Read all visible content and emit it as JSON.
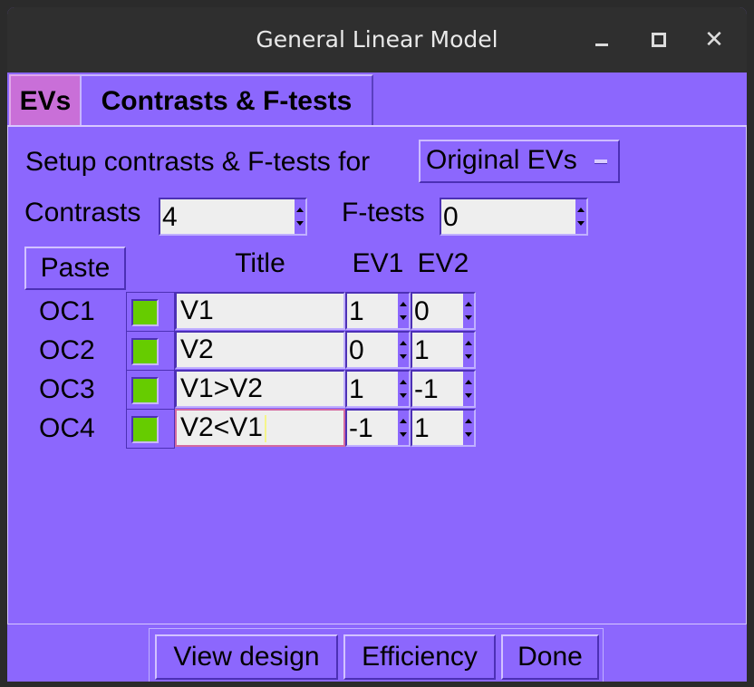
{
  "window": {
    "title": "General Linear Model",
    "controls": {
      "minimize": "minimize",
      "maximize": "maximize",
      "close": "✕"
    }
  },
  "tabs": [
    {
      "label": "EVs",
      "active": false
    },
    {
      "label": "Contrasts & F-tests",
      "active": true
    }
  ],
  "setup": {
    "label": "Setup contrasts & F-tests for",
    "selected": "Original EVs"
  },
  "counts": {
    "contrasts_label": "Contrasts",
    "contrasts_value": "4",
    "ftests_label": "F-tests",
    "ftests_value": "0"
  },
  "table": {
    "paste_label": "Paste",
    "headers": {
      "title": "Title",
      "ev1": "EV1",
      "ev2": "EV2"
    },
    "rows": [
      {
        "label": "OC1",
        "title": "V1",
        "ev1": "1",
        "ev2": "0"
      },
      {
        "label": "OC2",
        "title": "V2",
        "ev1": "0",
        "ev2": "1"
      },
      {
        "label": "OC3",
        "title": "V1>V2",
        "ev1": "1",
        "ev2": "-1"
      },
      {
        "label": "OC4",
        "title": "V2<V1",
        "ev1": "-1",
        "ev2": "1"
      }
    ]
  },
  "footer": {
    "view_design": "View design",
    "efficiency": "Efficiency",
    "done": "Done"
  },
  "colors": {
    "background": "#8c67fd",
    "titlebar": "#2f2f2f",
    "evs_tab": "#c96fd8",
    "contrast_swatch": "#66cc00",
    "field": "#eeeeee"
  }
}
